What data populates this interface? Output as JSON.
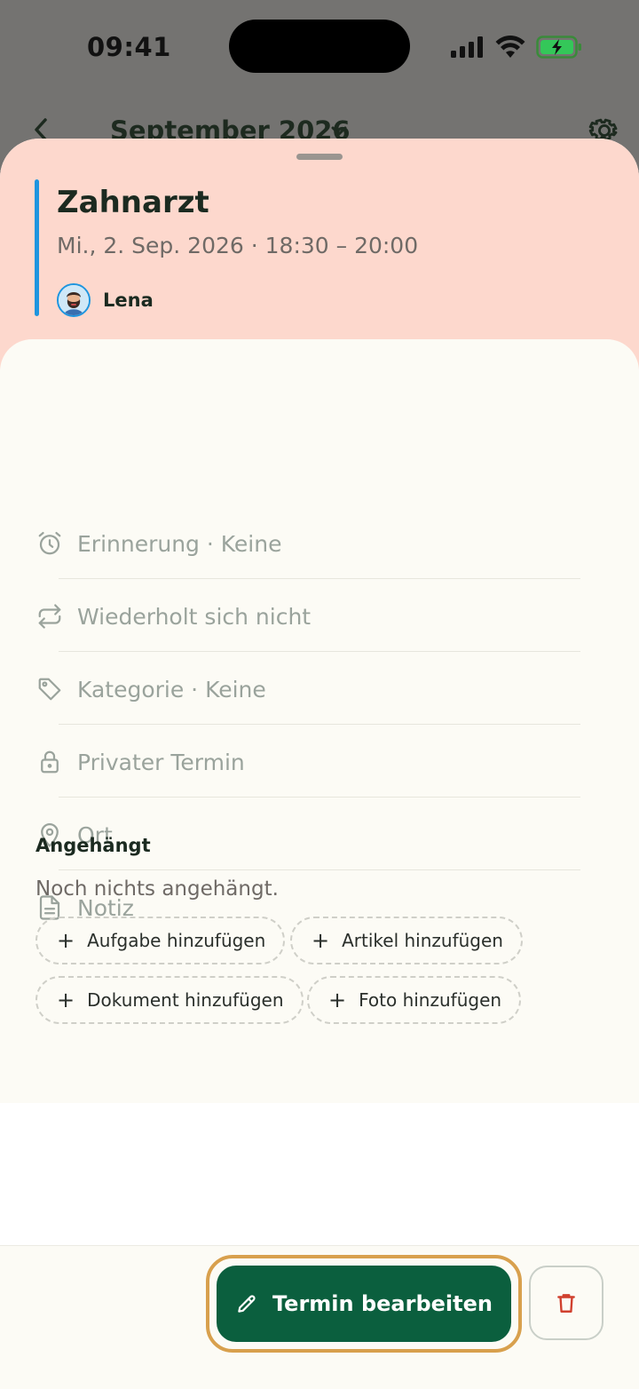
{
  "status_bar": {
    "time": "09:41"
  },
  "background_header": {
    "title": "September 2026"
  },
  "event": {
    "title": "Zahnarzt",
    "datetime": "Mi., 2. Sep. 2026 · 18:30 – 20:00",
    "person": "Lena",
    "accent_color": "#1e95df",
    "header_color": "#fdd8cd"
  },
  "details": {
    "reminder": "Erinnerung · Keine",
    "repeat": "Wiederholt sich nicht",
    "category": "Kategorie · Keine",
    "private": "Privater Termin",
    "location": "Ort",
    "note": "Notiz"
  },
  "attached": {
    "title": "Angehängt",
    "empty_text": "Noch nichts angehängt.",
    "chips": {
      "task": "Aufgabe hinzufügen",
      "item": "Artikel hinzufügen",
      "document": "Dokument hinzufügen",
      "photo": "Foto hinzufügen"
    }
  },
  "actions": {
    "edit_label": "Termin bearbeiten",
    "primary_color": "#0b5f3e",
    "focus_ring_color": "#d8a04d",
    "delete_color": "#d0402e"
  },
  "icons": {
    "reminder": "alarm-clock-icon",
    "repeat": "repeat-icon",
    "category": "tag-icon",
    "private": "lock-icon",
    "location": "map-pin-icon",
    "note": "document-icon",
    "edit": "pencil-icon",
    "delete": "trash-icon"
  }
}
